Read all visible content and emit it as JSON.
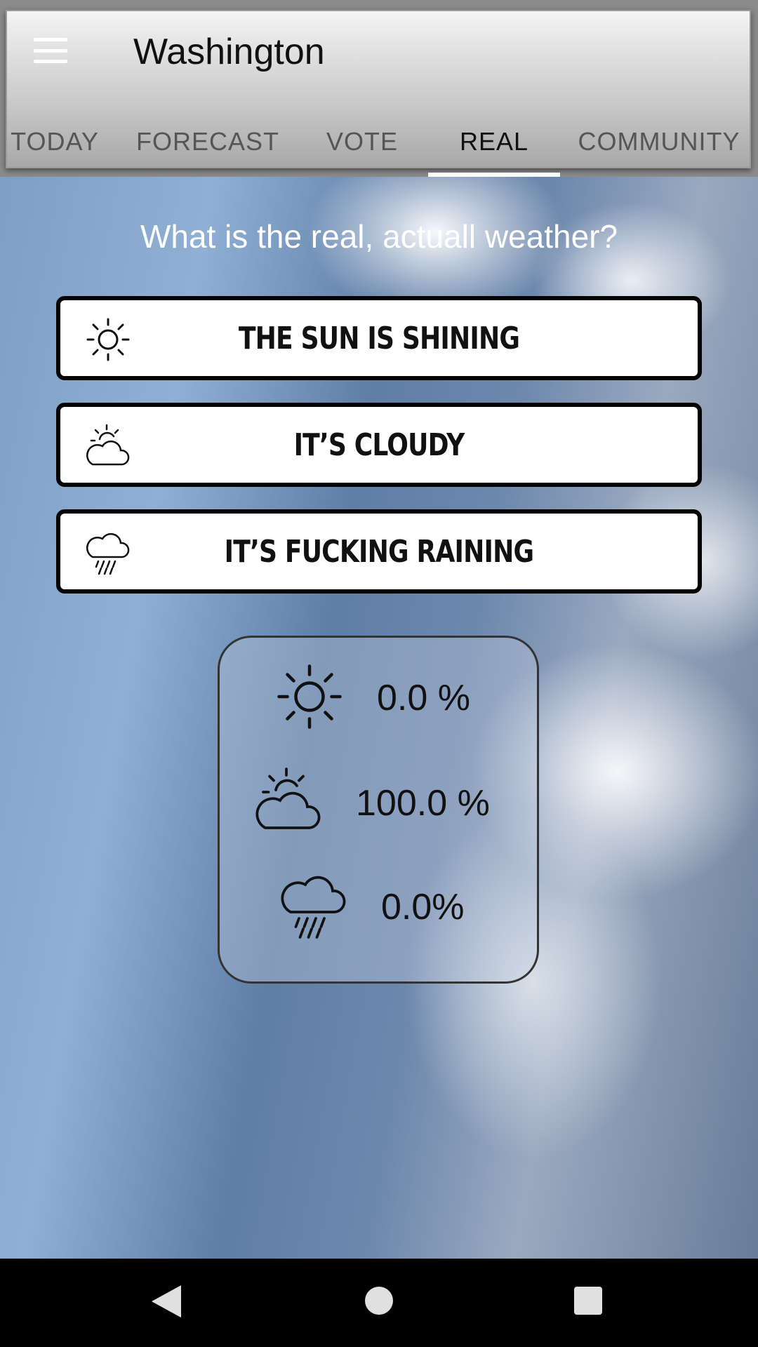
{
  "appbar": {
    "title": "Washington",
    "menu_icon": "hamburger-menu-icon"
  },
  "tabs": [
    {
      "label": "TODAY"
    },
    {
      "label": "FORECAST"
    },
    {
      "label": "VOTE"
    },
    {
      "label": "REAL",
      "active": true
    },
    {
      "label": "COMMUNITY"
    }
  ],
  "main": {
    "question": "What is the real, actuall weather?",
    "choices": [
      {
        "label": "THE SUN IS SHINING",
        "icon": "sun-icon"
      },
      {
        "label": "IT’S CLOUDY",
        "icon": "partly-cloudy-icon"
      },
      {
        "label": "IT’S FUCKING RAINING",
        "icon": "rain-cloud-icon"
      }
    ],
    "results": [
      {
        "icon": "sun-icon",
        "value": "0.0 %"
      },
      {
        "icon": "partly-cloudy-icon",
        "value": "100.0 %"
      },
      {
        "icon": "rain-cloud-icon",
        "value": "0.0%"
      }
    ]
  },
  "navbar": {
    "back_icon": "back-triangle-icon",
    "home_icon": "home-circle-icon",
    "recents_icon": "recents-square-icon"
  },
  "colors": {
    "active_tab_indicator": "#ffffff",
    "tab_inactive": "#555555",
    "tab_active": "#111111"
  }
}
